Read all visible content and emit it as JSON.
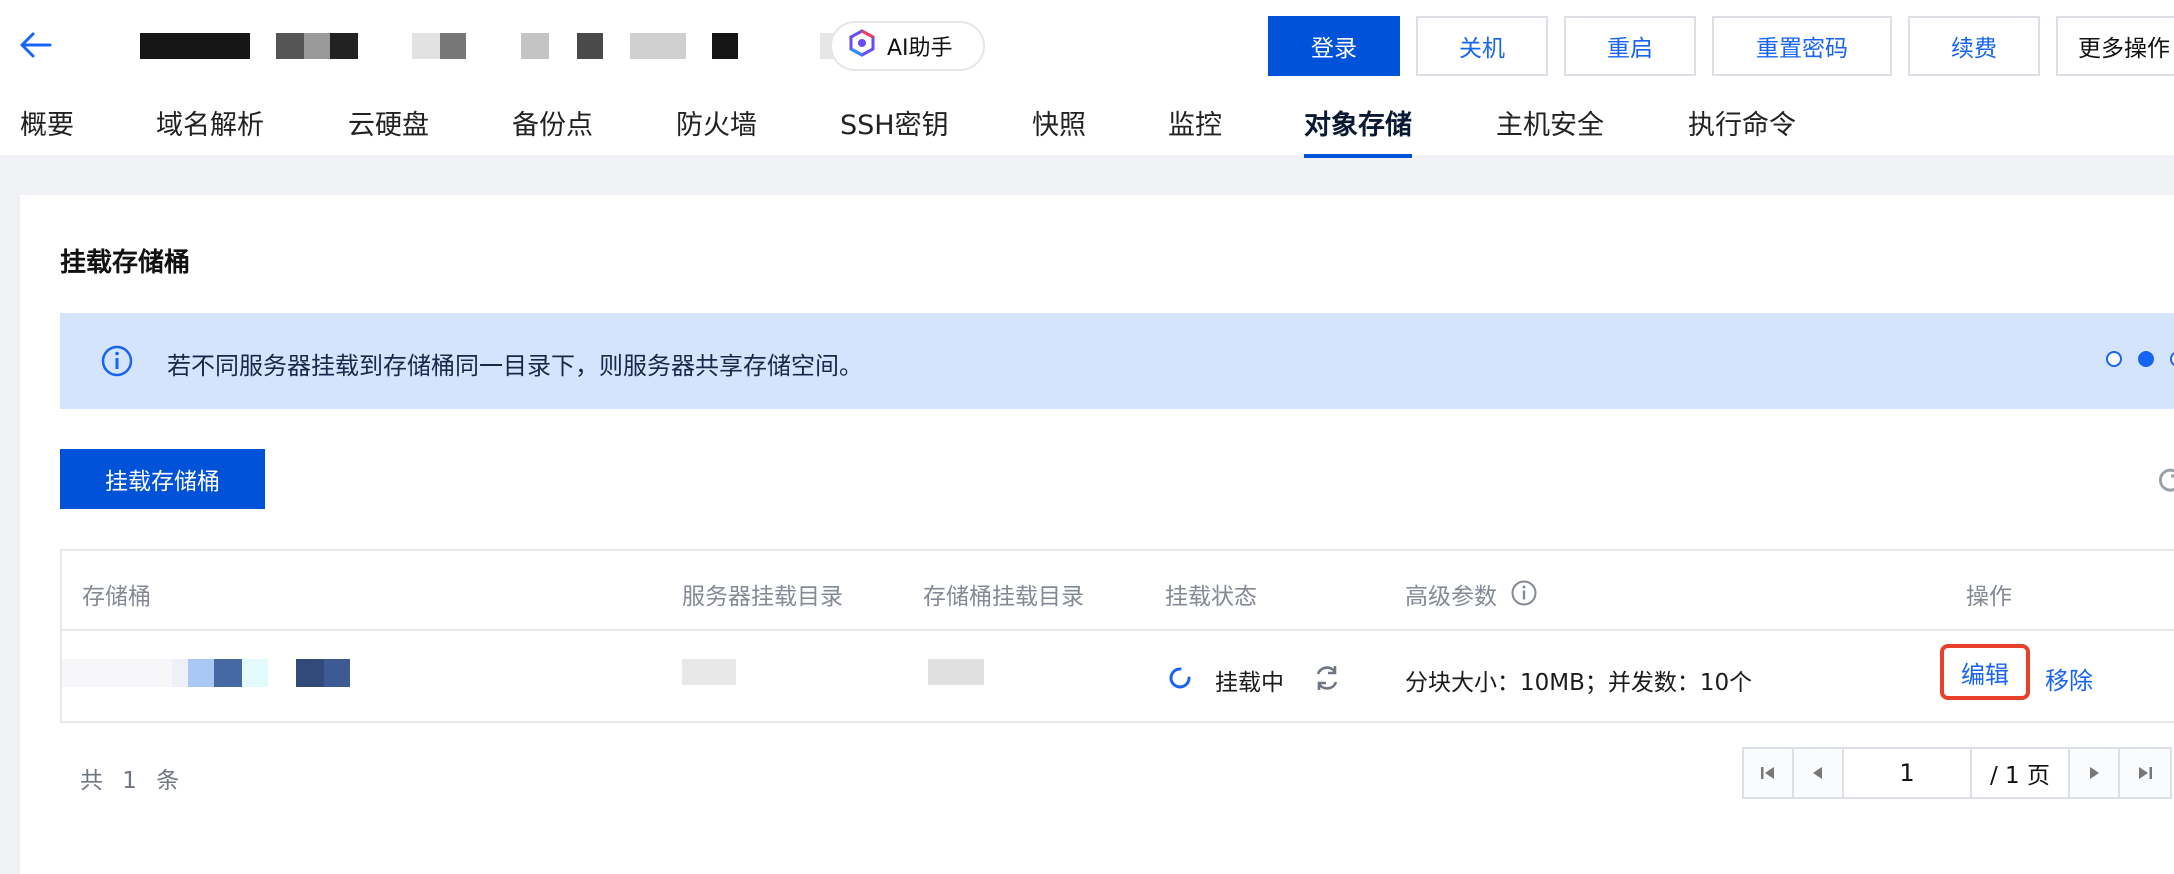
{
  "header": {
    "ai_assistant_label": "AI助手",
    "buttons": {
      "login": "登录",
      "shutdown": "关机",
      "restart": "重启",
      "reset_password": "重置密码",
      "renew": "续费",
      "more_actions": "更多操作"
    }
  },
  "tabs": [
    {
      "label": "概要"
    },
    {
      "label": "域名解析"
    },
    {
      "label": "云硬盘"
    },
    {
      "label": "备份点"
    },
    {
      "label": "防火墙"
    },
    {
      "label": "SSH密钥"
    },
    {
      "label": "快照"
    },
    {
      "label": "监控"
    },
    {
      "label": "对象存储",
      "active": true
    },
    {
      "label": "主机安全"
    },
    {
      "label": "执行命令"
    }
  ],
  "panel": {
    "title": "挂载存储桶",
    "notice_text": "若不同服务器挂载到存储桶同一目录下，则服务器共享存储空间。",
    "mount_button": "挂载存储桶"
  },
  "table": {
    "headers": {
      "bucket": "存储桶",
      "server_dir": "服务器挂载目录",
      "bucket_dir": "存储桶挂载目录",
      "status": "挂载状态",
      "advanced": "高级参数",
      "actions": "操作"
    },
    "rows": [
      {
        "status": "挂载中",
        "params": "分块大小：10MB；并发数：10个",
        "edit": "编辑",
        "remove": "移除"
      }
    ]
  },
  "footer": {
    "total": "共 1 条",
    "page_input": "1",
    "page_total": "/ 1 页"
  },
  "colors": {
    "primary": "#0052d9",
    "link": "#1764f4",
    "notice_bg": "#d5e4fd",
    "highlight_border": "#e8412b"
  },
  "icons": {
    "back": "arrow-left-icon",
    "ai": "ai-logo-icon",
    "info": "info-icon",
    "refresh": "refresh-icon",
    "loading": "loading-spinner-icon",
    "first_page": "first-page-icon",
    "prev_page": "prev-page-icon",
    "next_page": "next-page-icon",
    "last_page": "last-page-icon"
  }
}
